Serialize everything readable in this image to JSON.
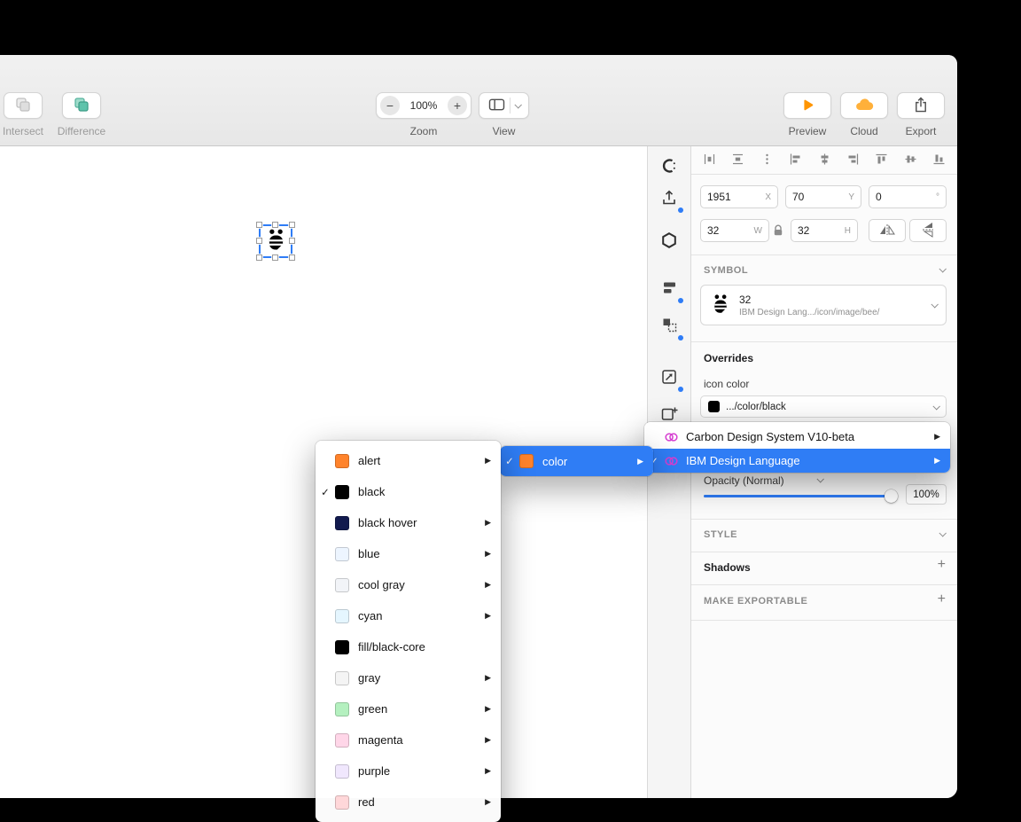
{
  "icons": {
    "check": "✓",
    "submenu_arrow": "▶",
    "plus": "+",
    "minus": "−"
  },
  "toolbar": {
    "intersect_label": "Intersect",
    "difference_label": "Difference",
    "zoom_value": "100%",
    "zoom_label": "Zoom",
    "view_label": "View",
    "preview_label": "Preview",
    "cloud_label": "Cloud",
    "export_label": "Export"
  },
  "inspector": {
    "x_value": "1951",
    "x_unit": "X",
    "y_value": "70",
    "y_unit": "Y",
    "rotation_value": "0",
    "rotation_unit": "°",
    "w_value": "32",
    "w_unit": "W",
    "h_value": "32",
    "h_unit": "H",
    "symbol_header": "SYMBOL",
    "symbol_name": "32",
    "symbol_path": "IBM Design Lang.../icon/image/bee/",
    "overrides_header": "Overrides",
    "override_label": "icon color",
    "override_value": ".../color/black",
    "opacity_label": "Opacity (Normal)",
    "opacity_value": "100%",
    "style_header": "STYLE",
    "shadows_label": "Shadows",
    "exportable_header": "MAKE EXPORTABLE"
  },
  "menus": {
    "libraries": [
      {
        "label": "Carbon Design System V10-beta",
        "checked": false,
        "selected": false,
        "arrow": true
      },
      {
        "label": "IBM Design Language",
        "checked": true,
        "selected": true,
        "arrow": true
      }
    ],
    "color_group": [
      {
        "label": "color",
        "swatch": "#ff832b",
        "checked": true,
        "selected": true,
        "arrow": true
      }
    ],
    "colors": [
      {
        "label": "alert",
        "swatch": "#ff832b",
        "checked": false,
        "arrow": true
      },
      {
        "label": "black",
        "swatch": "#000000",
        "checked": true,
        "arrow": false
      },
      {
        "label": "black hover",
        "swatch": "#121a4e",
        "checked": false,
        "arrow": true
      },
      {
        "label": "blue",
        "swatch": "#edf5ff",
        "checked": false,
        "arrow": true
      },
      {
        "label": "cool gray",
        "swatch": "#f2f4f8",
        "checked": false,
        "arrow": true
      },
      {
        "label": "cyan",
        "swatch": "#e5f6ff",
        "checked": false,
        "arrow": true
      },
      {
        "label": "fill/black-core",
        "swatch": "#000000",
        "checked": false,
        "arrow": false
      },
      {
        "label": "gray",
        "swatch": "#f4f4f4",
        "checked": false,
        "arrow": true
      },
      {
        "label": "green",
        "swatch": "#b4f0bf",
        "checked": false,
        "arrow": true
      },
      {
        "label": "magenta",
        "swatch": "#ffd6e8",
        "checked": false,
        "arrow": true
      },
      {
        "label": "purple",
        "swatch": "#f0e7fd",
        "checked": false,
        "arrow": true
      },
      {
        "label": "red",
        "swatch": "#ffd7d9",
        "checked": false,
        "arrow": true
      }
    ]
  },
  "colors": {
    "accent_blue": "#2e7cf6",
    "menu_highlight": "#2f7df5",
    "preview_orange": "#ff9500",
    "cloud_orange": "#ffb03a",
    "library_magenta": "#d63fd1"
  }
}
